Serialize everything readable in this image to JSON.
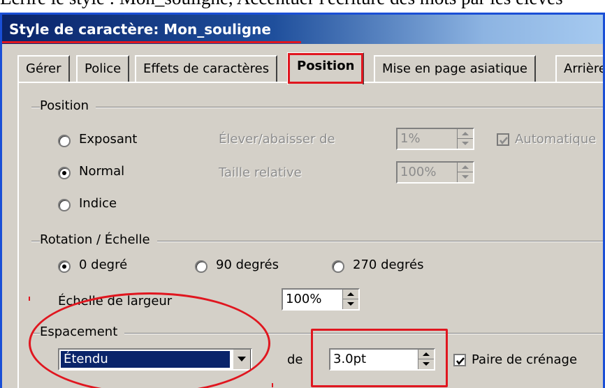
{
  "caption": "Ecrire le style : Mon_souligné, Accentuer l'écriture des mots par les élèves",
  "window": {
    "title": "Style de caractère: Mon_souligne"
  },
  "tabs": [
    {
      "label": "Gérer",
      "active": false
    },
    {
      "label": "Police",
      "active": false
    },
    {
      "label": "Effets de caractères",
      "active": false
    },
    {
      "label": "Position",
      "active": true
    },
    {
      "label": "Mise en page asiatique",
      "active": false
    },
    {
      "label": "Arrière",
      "active": false
    }
  ],
  "position_group": {
    "label": "Position",
    "options": [
      {
        "label": "Exposant",
        "checked": false
      },
      {
        "label": "Normal",
        "checked": true
      },
      {
        "label": "Indice",
        "checked": false
      }
    ],
    "raise_label": "Élever/abaisser de",
    "raise_value": "1%",
    "relative_size_label": "Taille relative",
    "relative_size_value": "100%",
    "automatic_label": "Automatique",
    "automatic_checked": true
  },
  "rotation_group": {
    "label": "Rotation / Échelle",
    "options": [
      {
        "label": "0 degré",
        "checked": true
      },
      {
        "label": "90 degrés",
        "checked": false
      },
      {
        "label": "270 degrés",
        "checked": false
      }
    ],
    "width_scale_label": "Échelle de largeur",
    "width_scale_value": "100%"
  },
  "spacing_group": {
    "label": "Espacement",
    "selected": "Étendu",
    "de_label": "de",
    "spacing_value": "3.0pt",
    "kerning_label": "Paire de crénage",
    "kerning_checked": true
  },
  "annotation_color": "#e0161f",
  "selection_color": "#0a246a"
}
